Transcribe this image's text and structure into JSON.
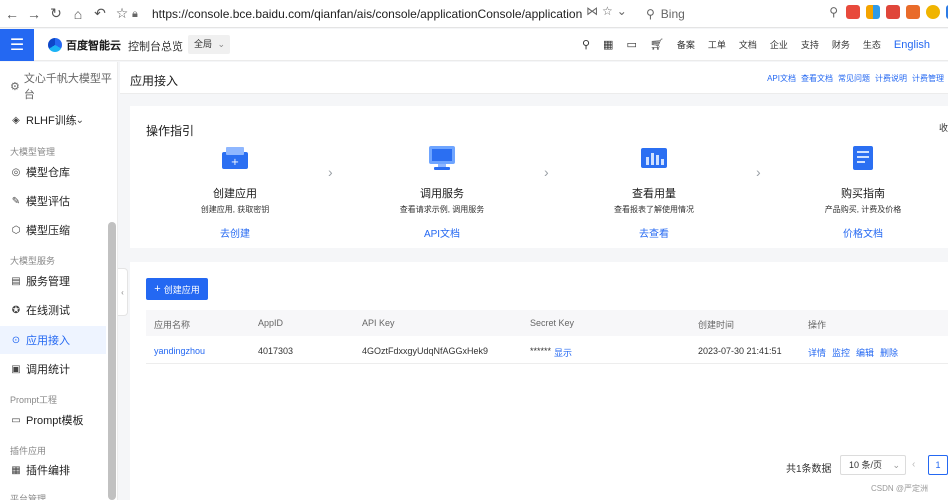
{
  "browser": {
    "url": "https://console.bce.baidu.com/qianfan/ais/console/applicationConsole/application",
    "search_placeholder": "Bing"
  },
  "topnav": {
    "brand": "百度智能云",
    "console_link": "控制台总览",
    "region": "全局",
    "items": [
      "备案",
      "工单",
      "文档",
      "企业",
      "支持",
      "财务",
      "生态"
    ],
    "lang": "English"
  },
  "sidebar": {
    "top_link": "文心千帆大模型平台",
    "rlhf": "RLHF训练",
    "group1": "大模型管理",
    "model_repo": "模型仓库",
    "model_eval": "模型评估",
    "model_compress": "模型压缩",
    "group2": "大模型服务",
    "service_mgmt": "服务管理",
    "online_test": "在线测试",
    "app_access": "应用接入",
    "call_stats": "调用统计",
    "group3": "Prompt工程",
    "prompt_template": "Prompt模板",
    "group4": "插件应用",
    "plugin_orchestrate": "插件编排",
    "group5": "平台管理"
  },
  "page": {
    "title": "应用接入",
    "links": [
      "API文档",
      "查看文档",
      "常见问题",
      "计费说明",
      "计费管理"
    ]
  },
  "guide": {
    "title": "操作指引",
    "collapse": "收",
    "steps": [
      {
        "name": "创建应用",
        "desc": "创建应用, 获取密钥",
        "link": "去创建"
      },
      {
        "name": "调用服务",
        "desc": "查看请求示例, 调用服务",
        "link": "API文档"
      },
      {
        "name": "查看用量",
        "desc": "查看报表了解使用情况",
        "link": "去查看"
      },
      {
        "name": "购买指南",
        "desc": "产品购买, 计费及价格",
        "link": "价格文档"
      }
    ]
  },
  "table": {
    "create_label": "创建应用",
    "headers": [
      "应用名称",
      "AppID",
      "API Key",
      "Secret Key",
      "创建时间",
      "操作"
    ],
    "row": {
      "name": "yandingzhou",
      "appid": "4017303",
      "api_key": "4GOztFdxxgyUdqNfAGGxHek9",
      "secret_mask": "******",
      "secret_show": "显示",
      "created": "2023-07-30 21:41:51",
      "ops": [
        "详情",
        "监控",
        "编辑",
        "删除"
      ]
    },
    "total": "共1条数据",
    "page_size": "10 条/页",
    "page": "1"
  },
  "watermark": "CSDN @严定洲",
  "colors": {
    "accent": "#2468f2"
  }
}
